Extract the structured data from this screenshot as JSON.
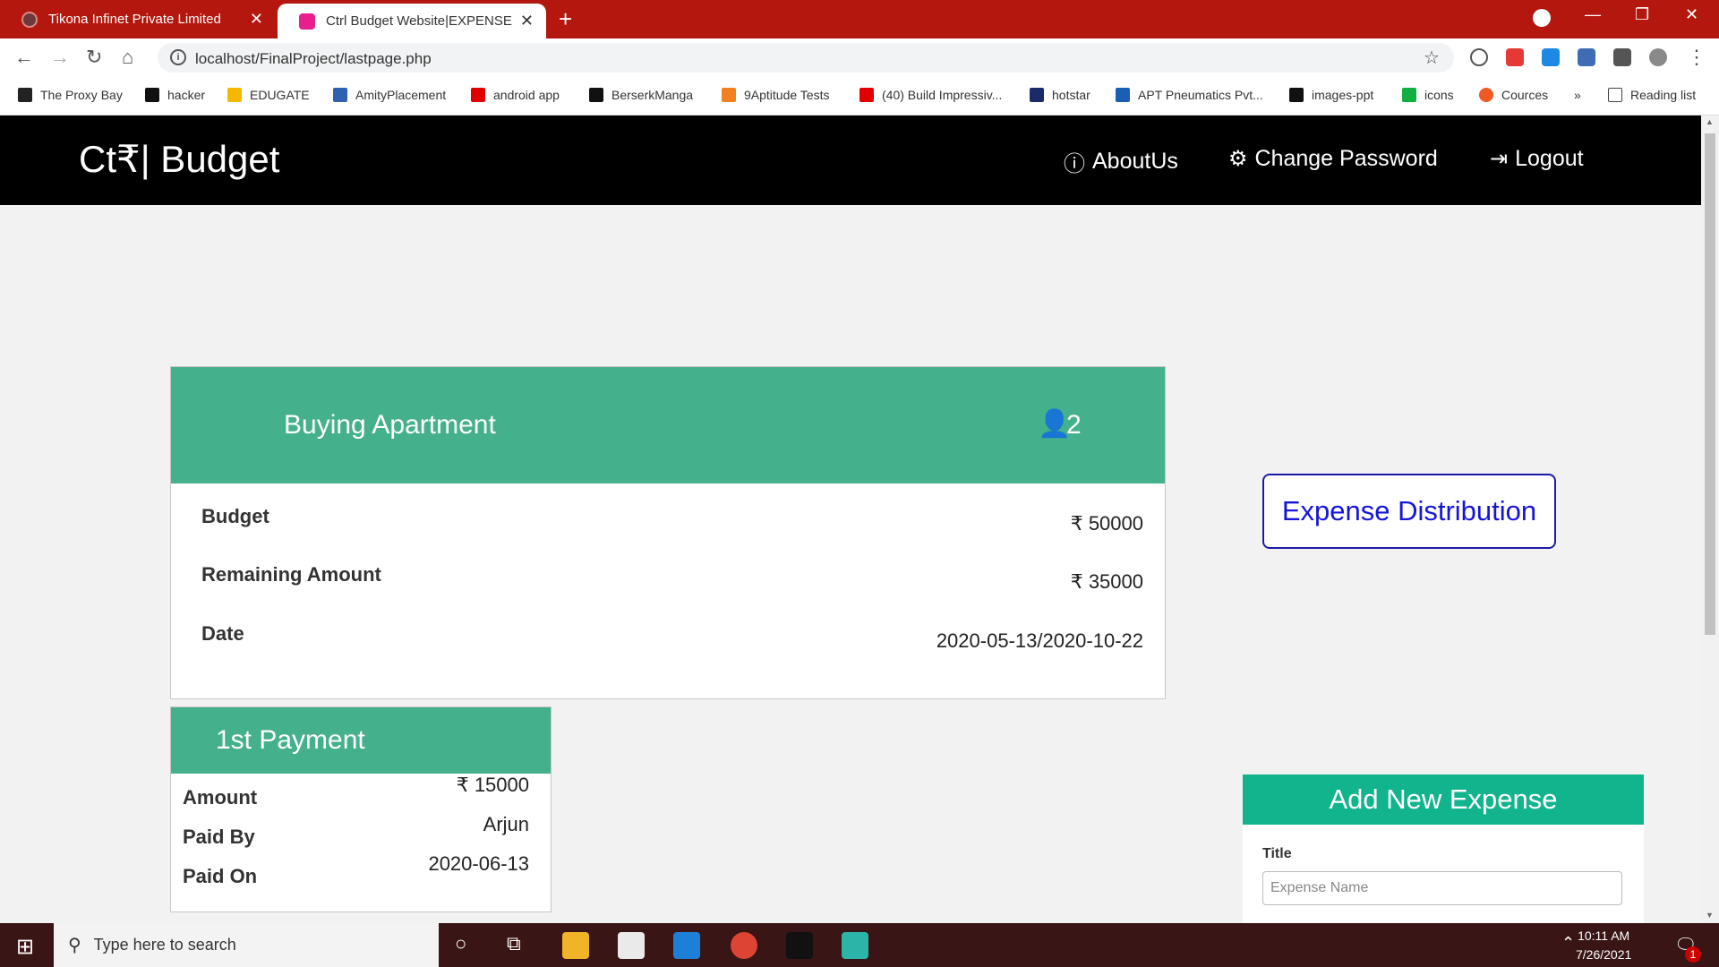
{
  "browser": {
    "tabs": [
      {
        "title": "Tikona Infinet Private Limited"
      },
      {
        "title": "Ctrl Budget Website|EXPENSE"
      }
    ],
    "url": "localhost/FinalProject/lastpage.php",
    "bookmarks": [
      {
        "label": "The Proxy Bay",
        "color": "#222222"
      },
      {
        "label": "hacker",
        "color": "#111111"
      },
      {
        "label": "EDUGATE",
        "color": "#f5b800"
      },
      {
        "label": "AmityPlacement",
        "color": "#3060b0"
      },
      {
        "label": "android app",
        "color": "#e00000"
      },
      {
        "label": "BerserkManga",
        "color": "#111111"
      },
      {
        "label": "9Aptitude Tests",
        "color": "#f08020"
      },
      {
        "label": "(40) Build Impressiv...",
        "color": "#e00000"
      },
      {
        "label": "hotstar",
        "color": "#1a2a6a"
      },
      {
        "label": "APT Pneumatics Pvt...",
        "color": "#1a5fb4"
      },
      {
        "label": "images-ppt",
        "color": "#111111"
      },
      {
        "label": "icons",
        "color": "#10b040"
      },
      {
        "label": "Cources",
        "color": "#ef5a24"
      }
    ],
    "reading_list": "Reading list",
    "more": "»"
  },
  "navbar": {
    "brand": "Ct₹| Budget",
    "about": "AboutUs",
    "change_password": "Change Password",
    "logout": "Logout"
  },
  "plan": {
    "title": "Buying Apartment",
    "members": "2",
    "budget_label": "Budget",
    "budget_value": "₹ 50000",
    "remaining_label": "Remaining Amount",
    "remaining_value": "₹ 35000",
    "date_label": "Date",
    "date_value": "2020-05-13/2020-10-22"
  },
  "expense_distribution": "Expense Distribution",
  "payment": {
    "title": "1st Payment",
    "amount_label": "Amount",
    "amount_value": "₹ 15000",
    "paid_by_label": "Paid By",
    "paid_by_value": "Arjun",
    "paid_on_label": "Paid On",
    "paid_on_value": "2020-06-13"
  },
  "add_expense": {
    "title": "Add New Expense",
    "title_label": "Title",
    "title_placeholder": "Expense Name"
  },
  "taskbar": {
    "search_placeholder": "Type here to search",
    "time": "10:11 AM",
    "date": "7/26/2021",
    "notifications": "1"
  }
}
